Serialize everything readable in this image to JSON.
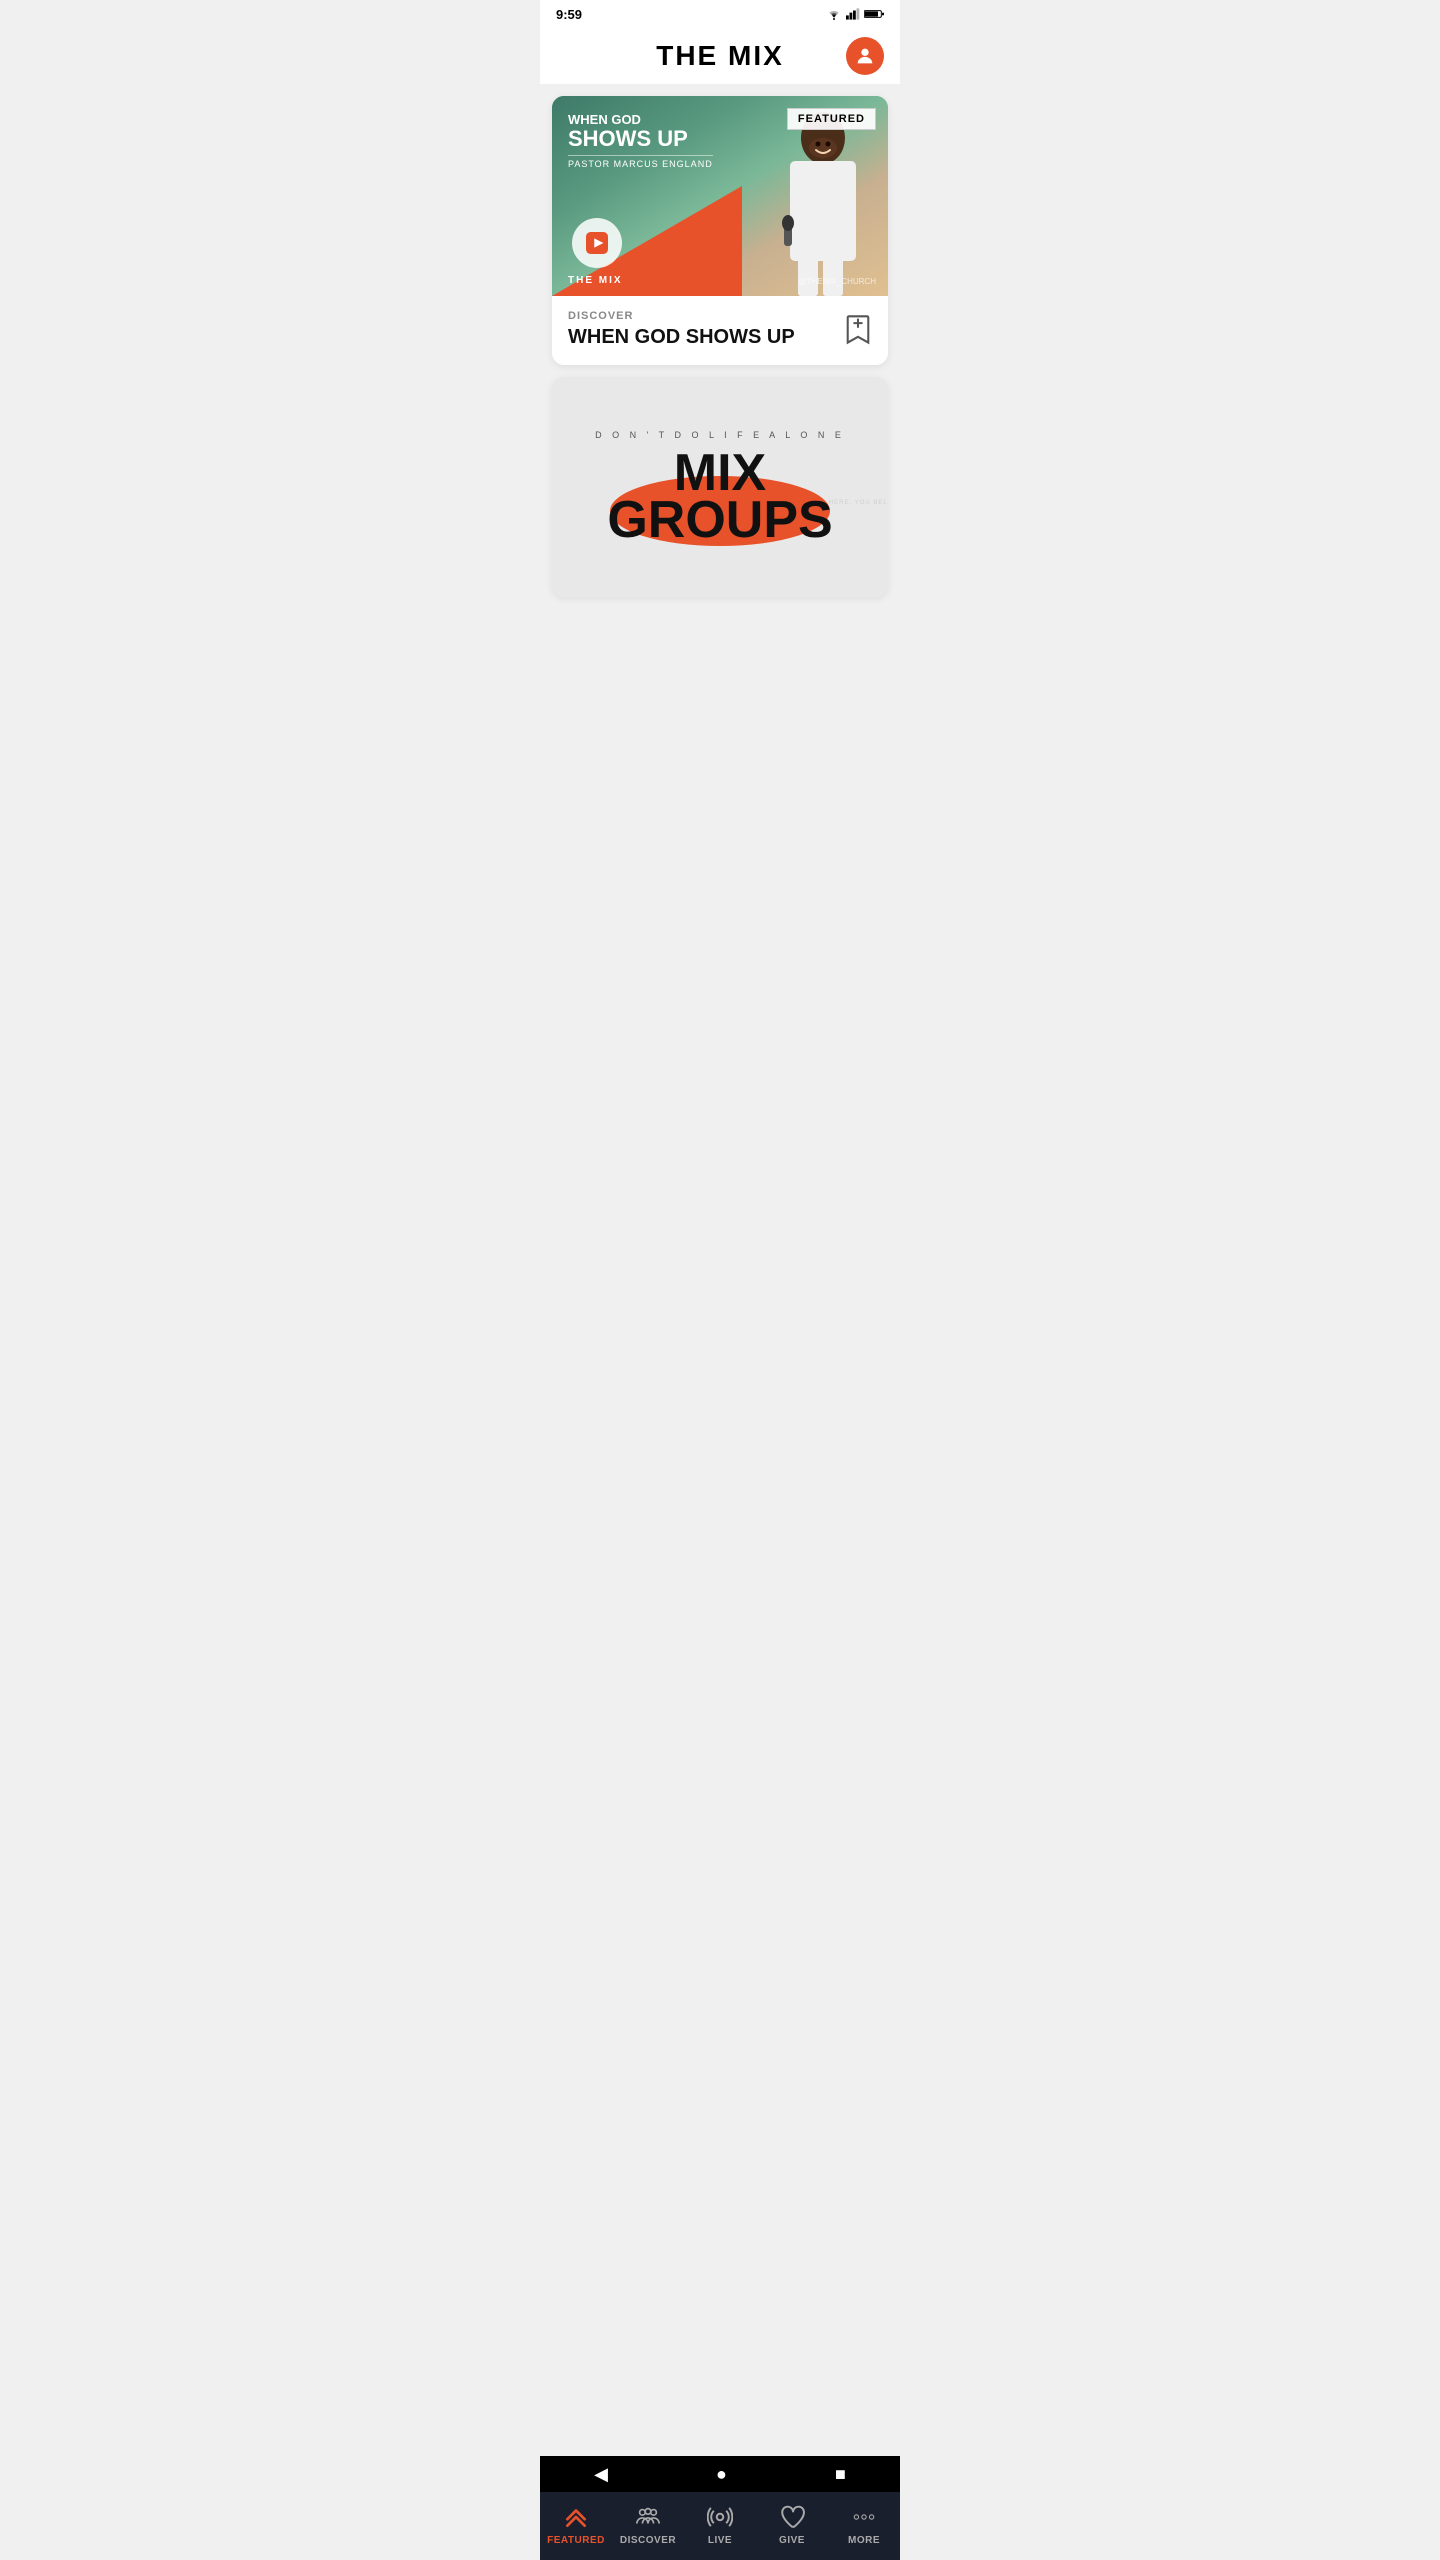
{
  "status_bar": {
    "time": "9:59"
  },
  "header": {
    "title": "THE MIX",
    "avatar_label": "User Profile"
  },
  "featured_card": {
    "badge": "FEATURED",
    "subtitle": "WHEN GOD",
    "title": "SHOWS UP",
    "pastor": "PASTOR MARCUS ENGLAND",
    "brand": "THE MIX",
    "watermark": "@THEMIX_CHURCH",
    "section_label": "DISCOVER",
    "card_title": "WHEN GOD SHOWS UP"
  },
  "groups_card": {
    "tagline": "D O N ' T   D O   L I F E   A L O N E",
    "line1": "MIX",
    "line2": "GROUPS",
    "repeated_text": "YOU BELONG HERE. YOU BELONG HERE. YOU BELONG HERE. YOU BELONG HERE. YOU BELONG HERE. YOU BELONG HERE."
  },
  "bottom_nav": {
    "items": [
      {
        "id": "featured",
        "label": "FEATURED",
        "active": true
      },
      {
        "id": "discover",
        "label": "DISCOVER",
        "active": false
      },
      {
        "id": "live",
        "label": "LIVE",
        "active": false
      },
      {
        "id": "give",
        "label": "GIVE",
        "active": false
      },
      {
        "id": "more",
        "label": "More",
        "active": false
      }
    ]
  },
  "android_nav": {
    "back": "◀",
    "home": "●",
    "recent": "■"
  },
  "colors": {
    "accent": "#e8522a",
    "nav_bg": "#1a1f2e",
    "nav_inactive": "#aaaaaa"
  }
}
